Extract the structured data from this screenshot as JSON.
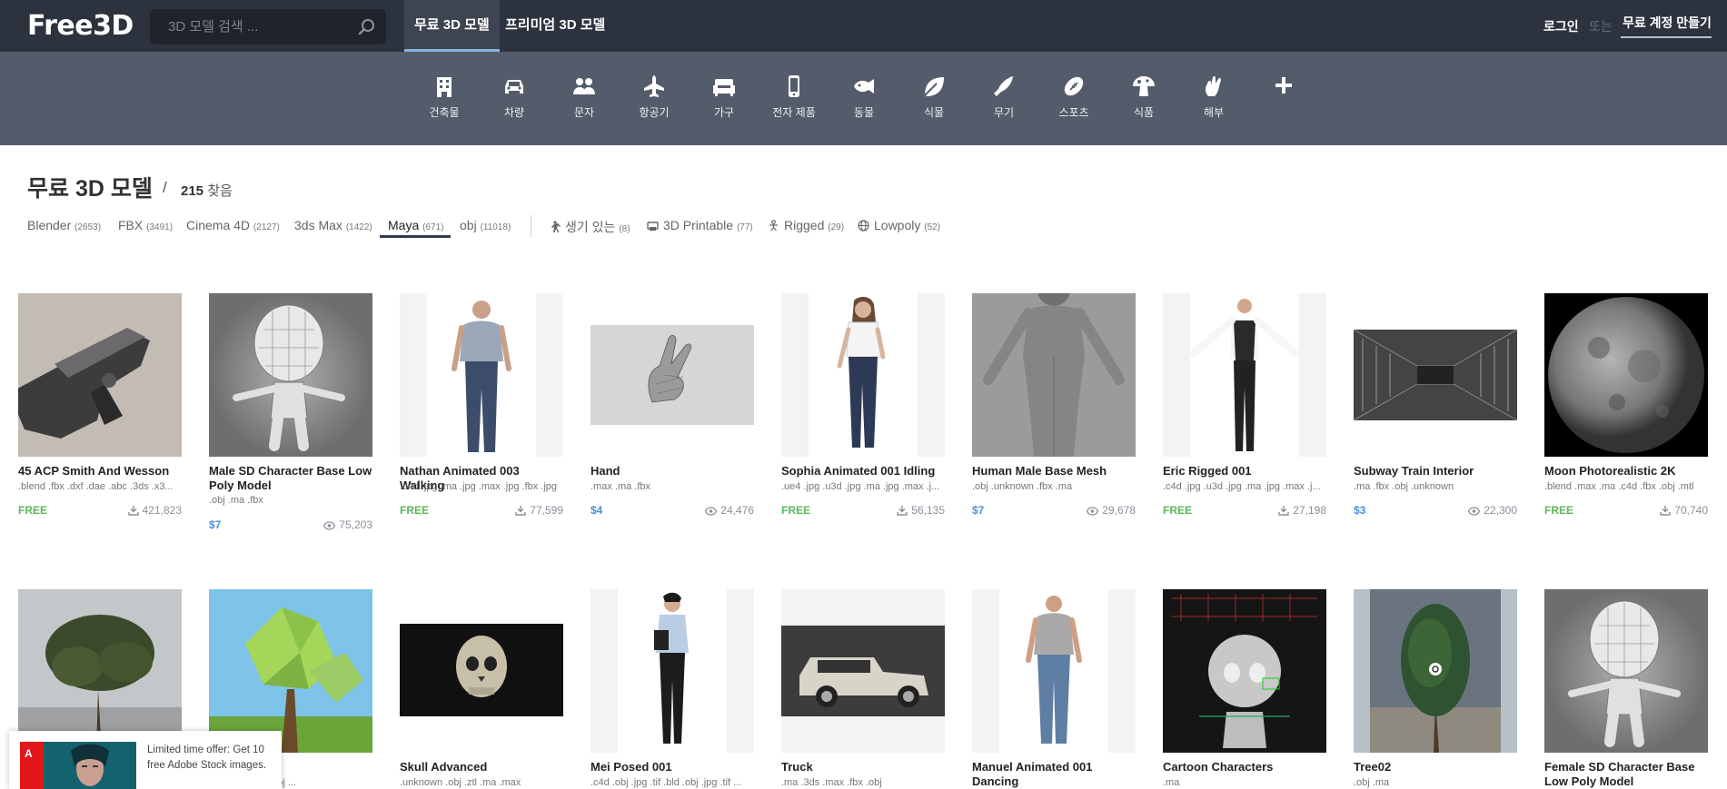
{
  "header": {
    "logo": "Free3D",
    "search_placeholder": "3D 모델 검색 ...",
    "tab_free": "무료 3D 모델",
    "tab_premium": "프리미엄 3D 모델",
    "login": "로그인",
    "or": "또는",
    "signup": "무료 계정 만들기"
  },
  "categories": [
    {
      "label": "건축물",
      "icon": "building-icon"
    },
    {
      "label": "차량",
      "icon": "car-icon"
    },
    {
      "label": "문자",
      "icon": "people-icon"
    },
    {
      "label": "항공기",
      "icon": "airplane-icon"
    },
    {
      "label": "가구",
      "icon": "sofa-icon"
    },
    {
      "label": "전자 제품",
      "icon": "phone-icon"
    },
    {
      "label": "동물",
      "icon": "fish-icon"
    },
    {
      "label": "식물",
      "icon": "leaf-icon"
    },
    {
      "label": "무기",
      "icon": "knife-icon"
    },
    {
      "label": "스포츠",
      "icon": "football-icon"
    },
    {
      "label": "식품",
      "icon": "mushroom-icon"
    },
    {
      "label": "해부",
      "icon": "hand-icon"
    },
    {
      "label": "",
      "icon": "plus-icon"
    }
  ],
  "page": {
    "title": "무료 3D 모델",
    "separator": "/",
    "count": "215",
    "count_suffix": "찾음"
  },
  "filters": [
    {
      "label": "Blender",
      "count": "(2653)"
    },
    {
      "label": "FBX",
      "count": "(3491)"
    },
    {
      "label": "Cinema 4D",
      "count": "(2127)"
    },
    {
      "label": "3ds Max",
      "count": "(1422)"
    },
    {
      "label": "Maya",
      "count": "(671)",
      "active": true
    },
    {
      "label": "obj",
      "count": "(11018)"
    },
    {
      "label": "생기 있는",
      "count": "(8)",
      "icon": "animated-icon"
    },
    {
      "label": "3D Printable",
      "count": "(77)",
      "icon": "printer-icon"
    },
    {
      "label": "Rigged",
      "count": "(29)",
      "icon": "rigged-icon"
    },
    {
      "label": "Lowpoly",
      "count": "(52)",
      "icon": "globe-icon"
    }
  ],
  "models": [
    {
      "title": "45 ACP Smith And Wesson",
      "formats": ".blend .fbx .dxf .dae .abc .3ds .x3...",
      "price": "FREE",
      "stat": "421,823",
      "stat_icon": "download-icon",
      "thumb": "pistol"
    },
    {
      "title": "Male SD Character Base Low Poly Model",
      "formats": ".obj .ma .fbx",
      "price": "$7",
      "stat": "75,203",
      "stat_icon": "eye-icon",
      "thumb": "chibi"
    },
    {
      "title": "Nathan Animated 003 Walking",
      "formats": ".c4d .jpg .ma .jpg .max .jpg .fbx .jpg",
      "price": "FREE",
      "stat": "77,599",
      "stat_icon": "download-icon",
      "thumb": "man-tshirt"
    },
    {
      "title": "Hand",
      "formats": ".max .ma .fbx",
      "price": "$4",
      "stat": "24,476",
      "stat_icon": "eye-icon",
      "thumb": "hand"
    },
    {
      "title": "Sophia Animated 001 Idling",
      "formats": ".ue4 .jpg .u3d .jpg .ma .jpg .max .j...",
      "price": "FREE",
      "stat": "56,135",
      "stat_icon": "download-icon",
      "thumb": "woman"
    },
    {
      "title": "Human Male Base Mesh",
      "formats": ".obj .unknown .fbx .ma",
      "price": "$7",
      "stat": "29,678",
      "stat_icon": "eye-icon",
      "thumb": "basemesh"
    },
    {
      "title": "Eric Rigged 001",
      "formats": ".c4d .jpg .u3d .jpg .ma .jpg .max .j...",
      "price": "FREE",
      "stat": "27,198",
      "stat_icon": "download-icon",
      "thumb": "suit"
    },
    {
      "title": "Subway Train Interior",
      "formats": ".ma .fbx .obj .unknown",
      "price": "$3",
      "stat": "22,300",
      "stat_icon": "eye-icon",
      "thumb": "train"
    },
    {
      "title": "Moon Photorealistic 2K",
      "formats": ".blend .max .ma .c4d .fbx .obj .mtl",
      "price": "FREE",
      "stat": "70,740",
      "stat_icon": "download-icon",
      "thumb": "moon"
    },
    {
      "title": "",
      "formats": "",
      "price": "",
      "stat": "",
      "thumb": "tree"
    },
    {
      "title": "e",
      "formats": ".dae .ma .lxo .obj ...",
      "price": "",
      "stat": "",
      "thumb": "lowpoly-tree"
    },
    {
      "title": "Skull Advanced",
      "formats": ".unknown .obj .ztl .ma .max",
      "price": "",
      "stat": "",
      "thumb": "skull"
    },
    {
      "title": "Mei Posed 001",
      "formats": ".c4d .obj .jpg .tif .bld .obj .jpg .tif ...",
      "price": "",
      "stat": "",
      "thumb": "mei"
    },
    {
      "title": "Truck",
      "formats": ".ma .3ds .max .fbx .obj",
      "price": "",
      "stat": "",
      "thumb": "truck"
    },
    {
      "title": "Manuel Animated 001 Dancing",
      "formats": "",
      "price": "",
      "stat": "",
      "thumb": "manuel"
    },
    {
      "title": "Cartoon Characters",
      "formats": ".ma",
      "price": "",
      "stat": "",
      "thumb": "cartoon"
    },
    {
      "title": "Tree02",
      "formats": ".obj .ma",
      "price": "",
      "stat": "",
      "thumb": "tree02"
    },
    {
      "title": "Female SD Character Base Low Poly Model",
      "formats": "",
      "price": "",
      "stat": "",
      "thumb": "chibi"
    }
  ],
  "ad": {
    "logo_text": "A",
    "text": "Limited time offer: Get 10 free Adobe Stock images."
  },
  "colors": {
    "header_bg": "#2d333e",
    "category_bg": "#545b6a",
    "free": "#5cb85c",
    "paid": "#4a90d9"
  }
}
